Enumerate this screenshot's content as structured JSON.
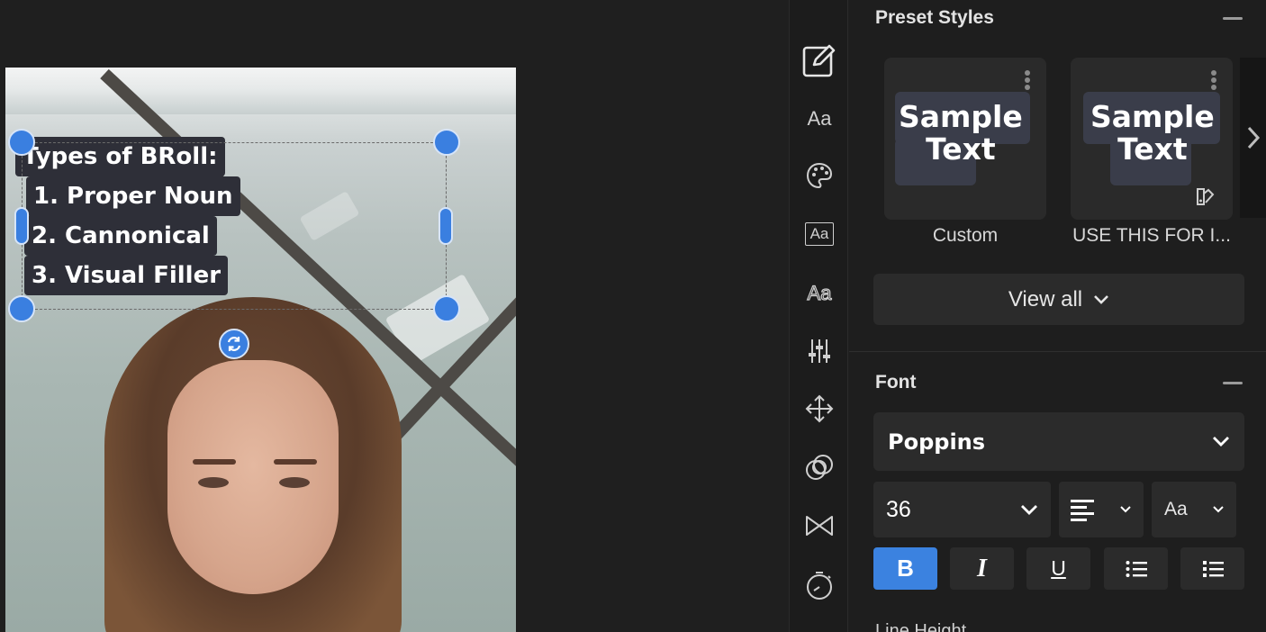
{
  "overlay": {
    "lines": [
      "Types of BRoll:",
      "1. Proper Noun",
      "2. Cannonical",
      "3. Visual Filler"
    ]
  },
  "tool_rail": {
    "items": [
      {
        "name": "edit-icon"
      },
      {
        "name": "text-icon",
        "label": "Aa"
      },
      {
        "name": "palette-icon"
      },
      {
        "name": "text-box-icon",
        "label": "Aa"
      },
      {
        "name": "text-style-icon",
        "label": "Aa"
      },
      {
        "name": "sliders-icon"
      },
      {
        "name": "move-icon"
      },
      {
        "name": "blend-icon"
      },
      {
        "name": "transition-icon"
      },
      {
        "name": "timer-icon"
      }
    ]
  },
  "preset_styles": {
    "title": "Preset Styles",
    "cards": [
      {
        "sample": "Sample\nText",
        "label": "Custom"
      },
      {
        "sample": "Sample\nText",
        "label": "USE THIS FOR I..."
      }
    ],
    "view_all": "View all"
  },
  "font": {
    "title": "Font",
    "family": "Poppins",
    "size": "36",
    "case_label": "Aa",
    "format_buttons": [
      {
        "name": "bold",
        "glyph": "B",
        "active": true
      },
      {
        "name": "italic",
        "glyph": "I",
        "active": false
      },
      {
        "name": "underline",
        "glyph": "U",
        "active": false
      },
      {
        "name": "bullet-list",
        "active": false
      },
      {
        "name": "numbered-list",
        "active": false
      }
    ],
    "next_section_partial": "Line Height"
  },
  "colors": {
    "accent": "#3b82e0",
    "panel_bg": "#1e1e1e",
    "control_bg": "#2b2b2b"
  }
}
